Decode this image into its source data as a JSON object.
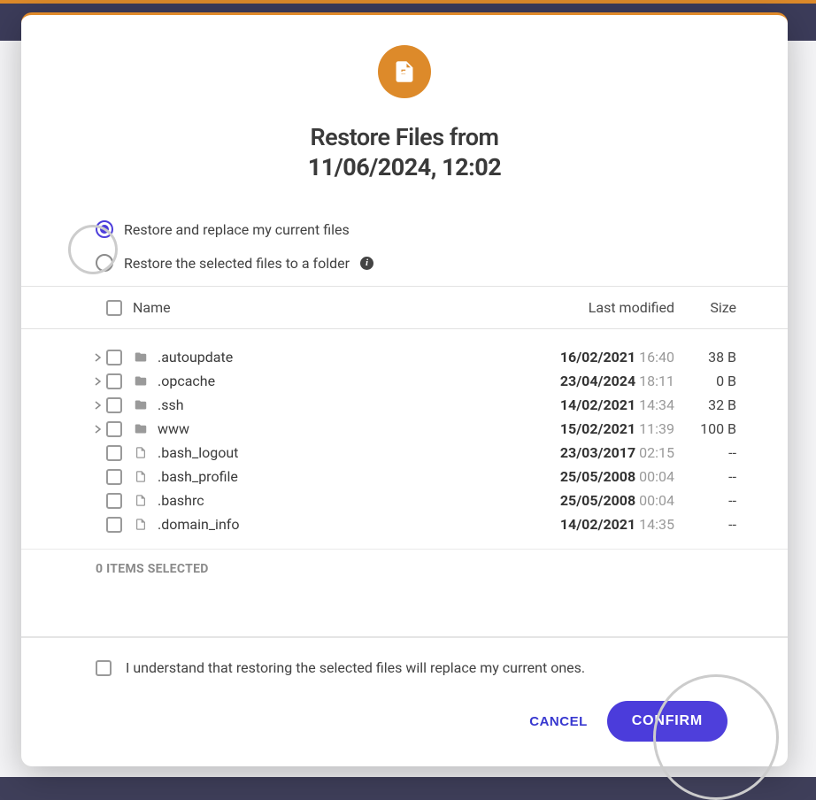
{
  "modal": {
    "title_prefix": "Restore Files from",
    "title_date": "11/06/2024, 12:02",
    "icon": "file-icon"
  },
  "options": {
    "replace_label": "Restore and replace my current files",
    "folder_label": "Restore the selected files to a folder",
    "selected": "replace"
  },
  "table": {
    "headers": {
      "name": "Name",
      "modified": "Last modified",
      "size": "Size"
    },
    "rows": [
      {
        "type": "folder",
        "name": ".autoupdate",
        "date": "16/02/2021",
        "time": "16:40",
        "size": "38 B",
        "expandable": true
      },
      {
        "type": "folder",
        "name": ".opcache",
        "date": "23/04/2024",
        "time": "18:11",
        "size": "0 B",
        "expandable": true
      },
      {
        "type": "folder",
        "name": ".ssh",
        "date": "14/02/2021",
        "time": "14:34",
        "size": "32 B",
        "expandable": true
      },
      {
        "type": "folder",
        "name": "www",
        "date": "15/02/2021",
        "time": "11:39",
        "size": "100 B",
        "expandable": true
      },
      {
        "type": "file",
        "name": ".bash_logout",
        "date": "23/03/2017",
        "time": "02:15",
        "size": "--",
        "expandable": false
      },
      {
        "type": "file",
        "name": ".bash_profile",
        "date": "25/05/2008",
        "time": "00:04",
        "size": "--",
        "expandable": false
      },
      {
        "type": "file",
        "name": ".bashrc",
        "date": "25/05/2008",
        "time": "00:04",
        "size": "--",
        "expandable": false
      },
      {
        "type": "file",
        "name": ".domain_info",
        "date": "14/02/2021",
        "time": "14:35",
        "size": "--",
        "expandable": false
      }
    ],
    "selection_count": "0 ITEMS SELECTED"
  },
  "confirm": {
    "understand_label": "I understand that restoring the selected files will replace my current ones."
  },
  "buttons": {
    "cancel": "CANCEL",
    "confirm": "CONFIRM"
  }
}
